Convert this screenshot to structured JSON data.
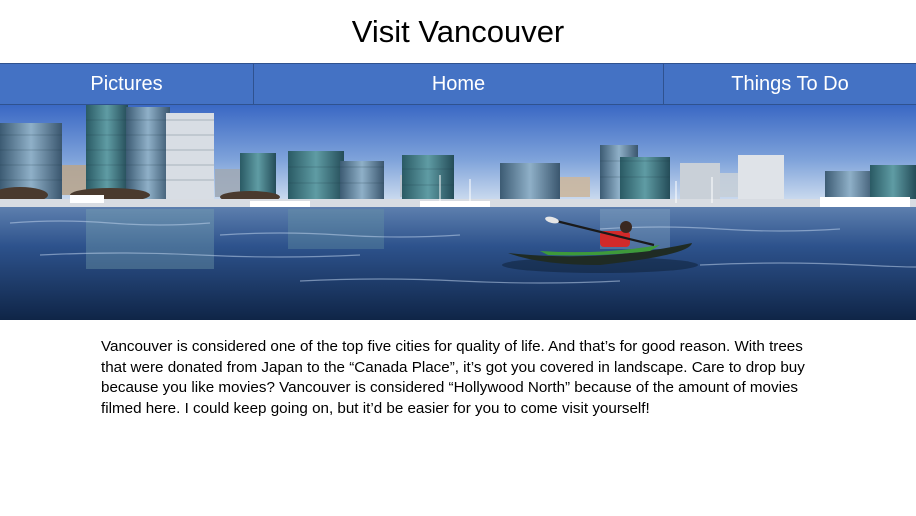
{
  "page": {
    "title": "Visit Vancouver"
  },
  "nav": {
    "items": [
      {
        "label": "Pictures"
      },
      {
        "label": "Home"
      },
      {
        "label": "Things To Do"
      }
    ]
  },
  "banner": {
    "subject": "Vancouver skyline with harbour and kayaker",
    "colors": {
      "sky_top": "#3f6fc9",
      "sky_bottom": "#c9d9ee",
      "water": "#2c4f86",
      "kayaker_jacket": "#d22a2a"
    }
  },
  "main": {
    "description": "Vancouver is considered one of the top five cities for quality of life. And that’s for good reason. With trees that were donated from Japan to the “Canada Place”, it’s got you covered in landscape. Care to drop buy because you like movies? Vancouver is considered “Hollywood North” because of the amount of movies filmed here. I could keep going on, but it’d be easier for you to come visit yourself!"
  },
  "colors": {
    "nav_background": "#4472c4",
    "nav_text": "#ffffff"
  }
}
